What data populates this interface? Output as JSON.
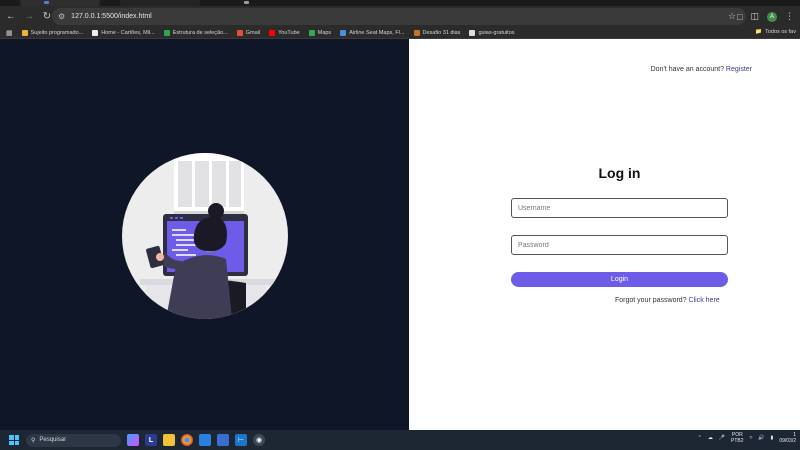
{
  "browser": {
    "url": "127.0.0.1:5500/index.html",
    "bookmarks": [
      {
        "label": "Sujeito programado...",
        "color": "#f2b134"
      },
      {
        "label": "Home - Cartões, Mil...",
        "color": "#111111"
      },
      {
        "label": "Estrutura de seleção...",
        "color": "#2aa84a"
      },
      {
        "label": "Gmail",
        "color": "#e74c3c"
      },
      {
        "label": "YouTube",
        "color": "#ff0000"
      },
      {
        "label": "Maps",
        "color": "#34a853"
      },
      {
        "label": "Airline Seat Maps, Fl...",
        "color": "#4a90d9"
      },
      {
        "label": "Desafio 31 dias",
        "color": "#c7722b"
      },
      {
        "label": "guias-gratuitos",
        "color": "#dddddd"
      }
    ],
    "all_bookmarks_label": "Todos os fav",
    "avatar_initial": "A"
  },
  "auth": {
    "no_account_text": "Don't have an account?",
    "register_link": "Register",
    "title": "Log in",
    "username_placeholder": "Username",
    "password_placeholder": "Password",
    "login_button": "Login",
    "forgot_text": "Forgot your password?",
    "forgot_link": "Click here"
  },
  "taskbar": {
    "search_label": "Pesquisar",
    "lang_top": "POR",
    "lang_bottom": "PTB2",
    "time": "1",
    "date": "09/03/2"
  },
  "colors": {
    "left_bg": "#0e1628",
    "accent": "#6c5ce7",
    "link": "#3b3d8f"
  }
}
